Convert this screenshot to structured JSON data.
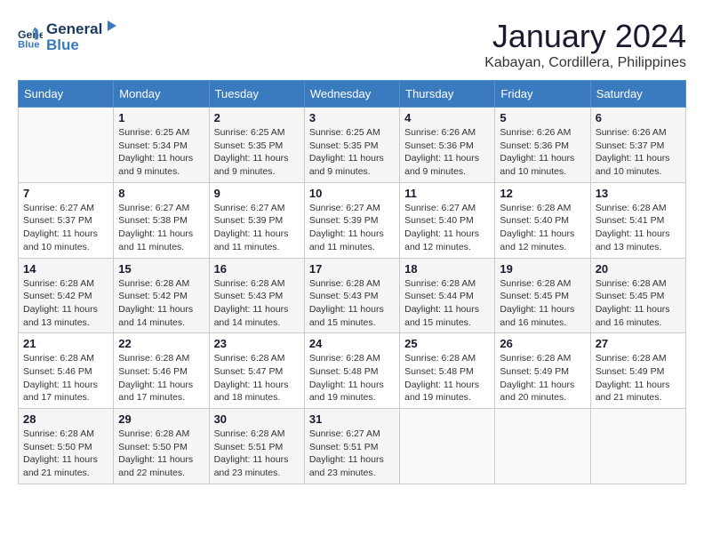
{
  "header": {
    "logo_line1": "General",
    "logo_line2": "Blue",
    "month": "January 2024",
    "location": "Kabayan, Cordillera, Philippines"
  },
  "days_of_week": [
    "Sunday",
    "Monday",
    "Tuesday",
    "Wednesday",
    "Thursday",
    "Friday",
    "Saturday"
  ],
  "weeks": [
    [
      {
        "num": "",
        "sunrise": "",
        "sunset": "",
        "daylight": ""
      },
      {
        "num": "1",
        "sunrise": "Sunrise: 6:25 AM",
        "sunset": "Sunset: 5:34 PM",
        "daylight": "Daylight: 11 hours and 9 minutes."
      },
      {
        "num": "2",
        "sunrise": "Sunrise: 6:25 AM",
        "sunset": "Sunset: 5:35 PM",
        "daylight": "Daylight: 11 hours and 9 minutes."
      },
      {
        "num": "3",
        "sunrise": "Sunrise: 6:25 AM",
        "sunset": "Sunset: 5:35 PM",
        "daylight": "Daylight: 11 hours and 9 minutes."
      },
      {
        "num": "4",
        "sunrise": "Sunrise: 6:26 AM",
        "sunset": "Sunset: 5:36 PM",
        "daylight": "Daylight: 11 hours and 9 minutes."
      },
      {
        "num": "5",
        "sunrise": "Sunrise: 6:26 AM",
        "sunset": "Sunset: 5:36 PM",
        "daylight": "Daylight: 11 hours and 10 minutes."
      },
      {
        "num": "6",
        "sunrise": "Sunrise: 6:26 AM",
        "sunset": "Sunset: 5:37 PM",
        "daylight": "Daylight: 11 hours and 10 minutes."
      }
    ],
    [
      {
        "num": "7",
        "sunrise": "Sunrise: 6:27 AM",
        "sunset": "Sunset: 5:37 PM",
        "daylight": "Daylight: 11 hours and 10 minutes."
      },
      {
        "num": "8",
        "sunrise": "Sunrise: 6:27 AM",
        "sunset": "Sunset: 5:38 PM",
        "daylight": "Daylight: 11 hours and 11 minutes."
      },
      {
        "num": "9",
        "sunrise": "Sunrise: 6:27 AM",
        "sunset": "Sunset: 5:39 PM",
        "daylight": "Daylight: 11 hours and 11 minutes."
      },
      {
        "num": "10",
        "sunrise": "Sunrise: 6:27 AM",
        "sunset": "Sunset: 5:39 PM",
        "daylight": "Daylight: 11 hours and 11 minutes."
      },
      {
        "num": "11",
        "sunrise": "Sunrise: 6:27 AM",
        "sunset": "Sunset: 5:40 PM",
        "daylight": "Daylight: 11 hours and 12 minutes."
      },
      {
        "num": "12",
        "sunrise": "Sunrise: 6:28 AM",
        "sunset": "Sunset: 5:40 PM",
        "daylight": "Daylight: 11 hours and 12 minutes."
      },
      {
        "num": "13",
        "sunrise": "Sunrise: 6:28 AM",
        "sunset": "Sunset: 5:41 PM",
        "daylight": "Daylight: 11 hours and 13 minutes."
      }
    ],
    [
      {
        "num": "14",
        "sunrise": "Sunrise: 6:28 AM",
        "sunset": "Sunset: 5:42 PM",
        "daylight": "Daylight: 11 hours and 13 minutes."
      },
      {
        "num": "15",
        "sunrise": "Sunrise: 6:28 AM",
        "sunset": "Sunset: 5:42 PM",
        "daylight": "Daylight: 11 hours and 14 minutes."
      },
      {
        "num": "16",
        "sunrise": "Sunrise: 6:28 AM",
        "sunset": "Sunset: 5:43 PM",
        "daylight": "Daylight: 11 hours and 14 minutes."
      },
      {
        "num": "17",
        "sunrise": "Sunrise: 6:28 AM",
        "sunset": "Sunset: 5:43 PM",
        "daylight": "Daylight: 11 hours and 15 minutes."
      },
      {
        "num": "18",
        "sunrise": "Sunrise: 6:28 AM",
        "sunset": "Sunset: 5:44 PM",
        "daylight": "Daylight: 11 hours and 15 minutes."
      },
      {
        "num": "19",
        "sunrise": "Sunrise: 6:28 AM",
        "sunset": "Sunset: 5:45 PM",
        "daylight": "Daylight: 11 hours and 16 minutes."
      },
      {
        "num": "20",
        "sunrise": "Sunrise: 6:28 AM",
        "sunset": "Sunset: 5:45 PM",
        "daylight": "Daylight: 11 hours and 16 minutes."
      }
    ],
    [
      {
        "num": "21",
        "sunrise": "Sunrise: 6:28 AM",
        "sunset": "Sunset: 5:46 PM",
        "daylight": "Daylight: 11 hours and 17 minutes."
      },
      {
        "num": "22",
        "sunrise": "Sunrise: 6:28 AM",
        "sunset": "Sunset: 5:46 PM",
        "daylight": "Daylight: 11 hours and 17 minutes."
      },
      {
        "num": "23",
        "sunrise": "Sunrise: 6:28 AM",
        "sunset": "Sunset: 5:47 PM",
        "daylight": "Daylight: 11 hours and 18 minutes."
      },
      {
        "num": "24",
        "sunrise": "Sunrise: 6:28 AM",
        "sunset": "Sunset: 5:48 PM",
        "daylight": "Daylight: 11 hours and 19 minutes."
      },
      {
        "num": "25",
        "sunrise": "Sunrise: 6:28 AM",
        "sunset": "Sunset: 5:48 PM",
        "daylight": "Daylight: 11 hours and 19 minutes."
      },
      {
        "num": "26",
        "sunrise": "Sunrise: 6:28 AM",
        "sunset": "Sunset: 5:49 PM",
        "daylight": "Daylight: 11 hours and 20 minutes."
      },
      {
        "num": "27",
        "sunrise": "Sunrise: 6:28 AM",
        "sunset": "Sunset: 5:49 PM",
        "daylight": "Daylight: 11 hours and 21 minutes."
      }
    ],
    [
      {
        "num": "28",
        "sunrise": "Sunrise: 6:28 AM",
        "sunset": "Sunset: 5:50 PM",
        "daylight": "Daylight: 11 hours and 21 minutes."
      },
      {
        "num": "29",
        "sunrise": "Sunrise: 6:28 AM",
        "sunset": "Sunset: 5:50 PM",
        "daylight": "Daylight: 11 hours and 22 minutes."
      },
      {
        "num": "30",
        "sunrise": "Sunrise: 6:28 AM",
        "sunset": "Sunset: 5:51 PM",
        "daylight": "Daylight: 11 hours and 23 minutes."
      },
      {
        "num": "31",
        "sunrise": "Sunrise: 6:27 AM",
        "sunset": "Sunset: 5:51 PM",
        "daylight": "Daylight: 11 hours and 23 minutes."
      },
      {
        "num": "",
        "sunrise": "",
        "sunset": "",
        "daylight": ""
      },
      {
        "num": "",
        "sunrise": "",
        "sunset": "",
        "daylight": ""
      },
      {
        "num": "",
        "sunrise": "",
        "sunset": "",
        "daylight": ""
      }
    ]
  ]
}
